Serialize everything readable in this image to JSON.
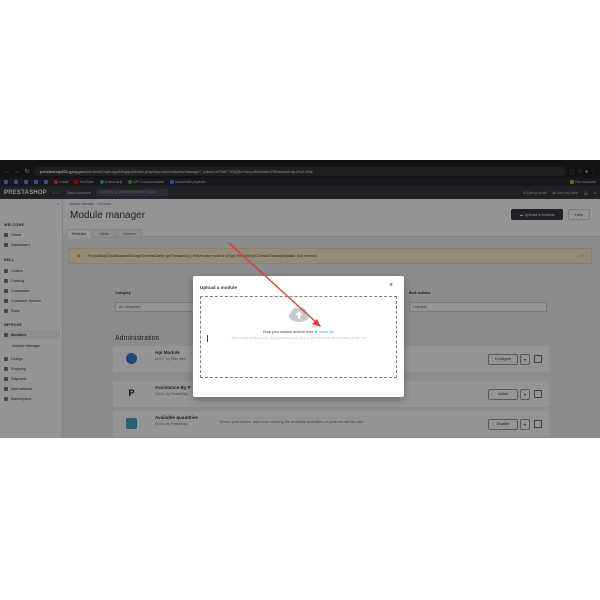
{
  "browser": {
    "url_host": "prestashop811.grey.pro",
    "url_path": "/admin187aqhuqpdfnhgqcd/index.php/improve/modules/manage?_token=a7NW-7X0Q5zY4rq-x8l4Mnbm7tKhwwaXmy-Zm2-Ohk",
    "bookmarks": [
      "Gmail",
      "YouTube",
      "Grammarly",
      "API Documentation",
      "findmiddle.phpin/er..."
    ],
    "bookmark_right": "Roc services"
  },
  "header": {
    "logo": "PRESTASHOP",
    "version": "8.1.1",
    "quick_access": "Quick Access ▾",
    "search_placeholder": "Search (e.g.: product reference, custo",
    "debug": "Debug mode",
    "view_store": "View my store"
  },
  "sidebar": {
    "groups": [
      "WELCOME",
      "SELL",
      "IMPROVE"
    ],
    "items": [
      "Home",
      "Dashboard",
      "Orders",
      "Catalog",
      "Customers",
      "Customer Service",
      "Stats",
      "Modules",
      "Module Manager",
      "Design",
      "Shipping",
      "Payment",
      "International",
      "Marketplace"
    ]
  },
  "page": {
    "breadcrumb_root": "Module Manager",
    "breadcrumb_leaf": "Modules",
    "title": "Module manager",
    "upload_label": "Upload a module",
    "help_label": "Help",
    "tabs": [
      "Modules",
      "Alerts",
      "Updates"
    ]
  },
  "warning": {
    "text": "PrestaShop\\CircuitBreaker\\Storage\\DoctrineCache::getTransaction(): Return value must be of type PrestaShop\\Contract\\Transaction|false, bool returned"
  },
  "filters": {
    "category_label": "Category",
    "category_value": "All categories",
    "bulk_label": "Bulk actions",
    "bulk_value": "Uninstall"
  },
  "section": {
    "title": "Administration"
  },
  "modules": [
    {
      "name": "Api Module",
      "version": "v1.0.0 - by Pires Web",
      "desc": "",
      "action": "Configure"
    },
    {
      "name": "Assistance By P",
      "version": "v1.0.0 - by PrestaShop",
      "desc": "",
      "action": "Install"
    },
    {
      "name": "Available quantities",
      "version": "v1.0.0 - by PrestaShop",
      "desc": "Enrich your stores, add a bar showing the available quantities of products still for sale.",
      "action": "Disable"
    }
  ],
  "modal": {
    "title": "Upload a module",
    "close": "×",
    "drop_text": "Drop your module archive here or ",
    "select_link": "select file",
    "note": "Please upload one file at a time, .zip or tarball format (.tar, .tar.gz or .tgz). Your module will be installed right after that."
  },
  "colors": {
    "accent": "#25b9d7",
    "header_dark": "#363a41",
    "warning_bg": "#fdf0d1",
    "annotation_arrow": "#e53935"
  }
}
